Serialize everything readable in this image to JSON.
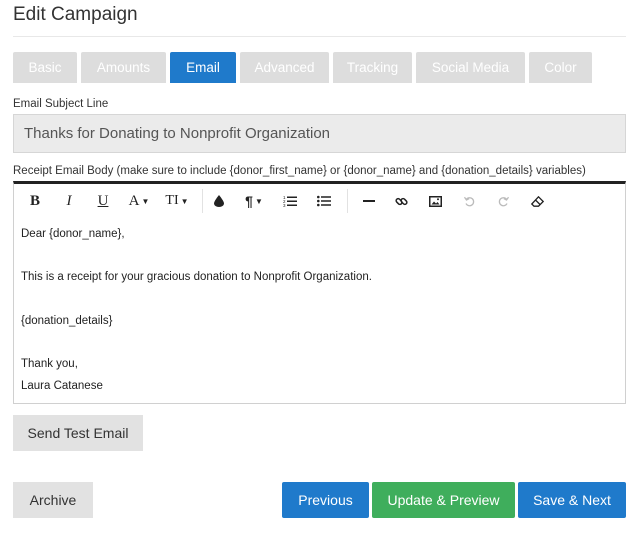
{
  "page": {
    "title": "Edit Campaign"
  },
  "tabs": [
    {
      "label": "Basic"
    },
    {
      "label": "Amounts"
    },
    {
      "label": "Email"
    },
    {
      "label": "Advanced"
    },
    {
      "label": "Tracking"
    },
    {
      "label": "Social Media"
    },
    {
      "label": "Color"
    }
  ],
  "active_tab": "Email",
  "subject": {
    "label": "Email Subject Line",
    "value": "Thanks for Donating to Nonprofit Organization"
  },
  "body": {
    "label": "Receipt Email Body (make sure to include {donor_first_name} or {donor_name} and {donation_details} variables)",
    "lines": [
      "Dear {donor_name},",
      "",
      "This is a receipt for your gracious donation to Nonprofit Organization.",
      "",
      "{donation_details}",
      "",
      "Thank you,",
      "Laura Catanese"
    ]
  },
  "toolbar": {
    "bold": "B",
    "italic": "I",
    "underline": "U",
    "font_color": "A",
    "font_size": "TI",
    "paragraph": "¶"
  },
  "buttons": {
    "send_test": "Send Test Email",
    "archive": "Archive",
    "previous": "Previous",
    "update_preview": "Update & Preview",
    "save_next": "Save & Next"
  },
  "colors": {
    "primary_blue": "#1f7acb",
    "success_green": "#3fae5c",
    "tab_inactive": "#dddddd"
  }
}
